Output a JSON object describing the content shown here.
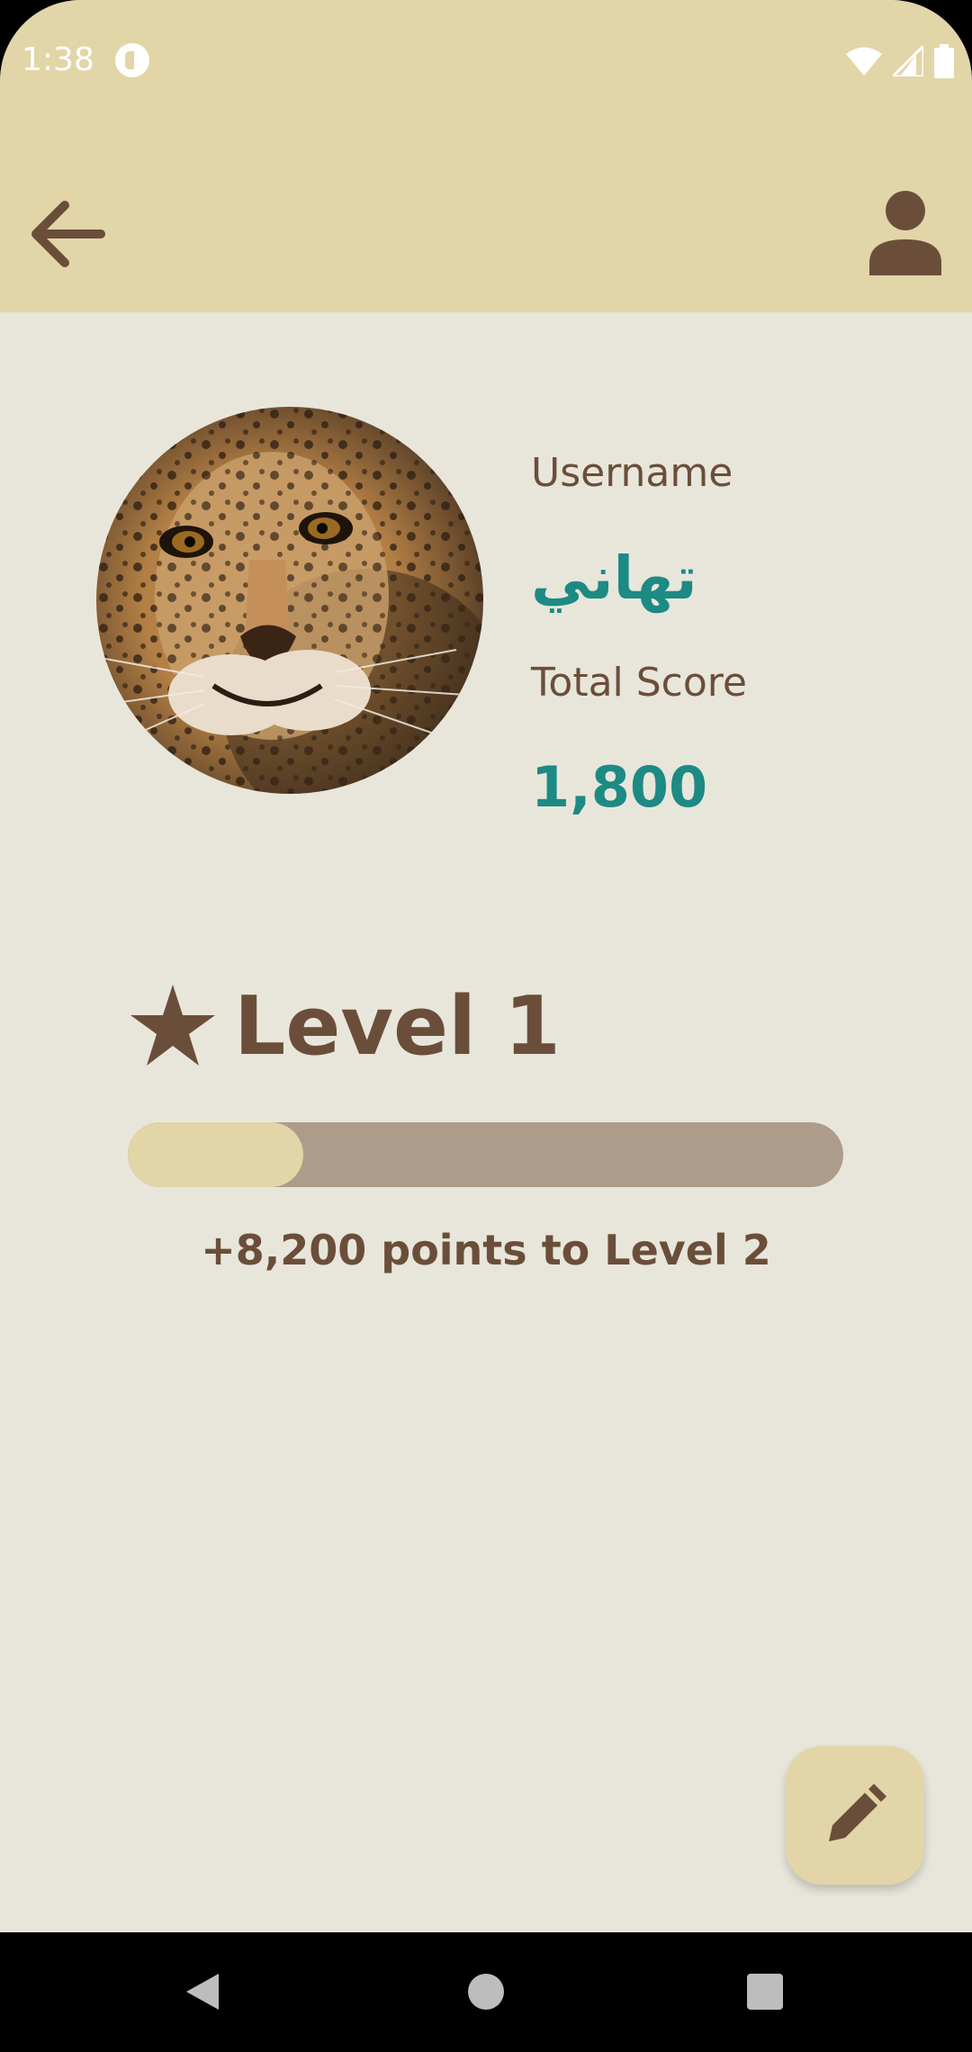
{
  "status_bar": {
    "time": "1:38",
    "app_icon": "notification-app-icon",
    "icons": [
      "wifi-icon",
      "cell-signal-icon",
      "battery-icon"
    ]
  },
  "app_bar": {
    "back_icon": "arrow-back-icon",
    "profile_icon": "person-icon"
  },
  "profile": {
    "avatar": "leopard-photo",
    "username_label": "Username",
    "username_value": "تهاني",
    "score_label": "Total Score",
    "score_value": "1,800"
  },
  "level": {
    "icon": "star-icon",
    "title": "Level 1",
    "progress_fraction": 0.245,
    "points_to_next": "+8,200 points to Level 2"
  },
  "fab": {
    "icon": "pencil-edit-icon"
  },
  "nav_bar": {
    "buttons": [
      "nav-back-icon",
      "nav-home-icon",
      "nav-recents-icon"
    ]
  },
  "colors": {
    "app_bar": "#e2d5a8",
    "background": "#e8e6db",
    "brown": "#6b4e3a",
    "teal": "#1d8a84",
    "track": "#ad9c89"
  }
}
